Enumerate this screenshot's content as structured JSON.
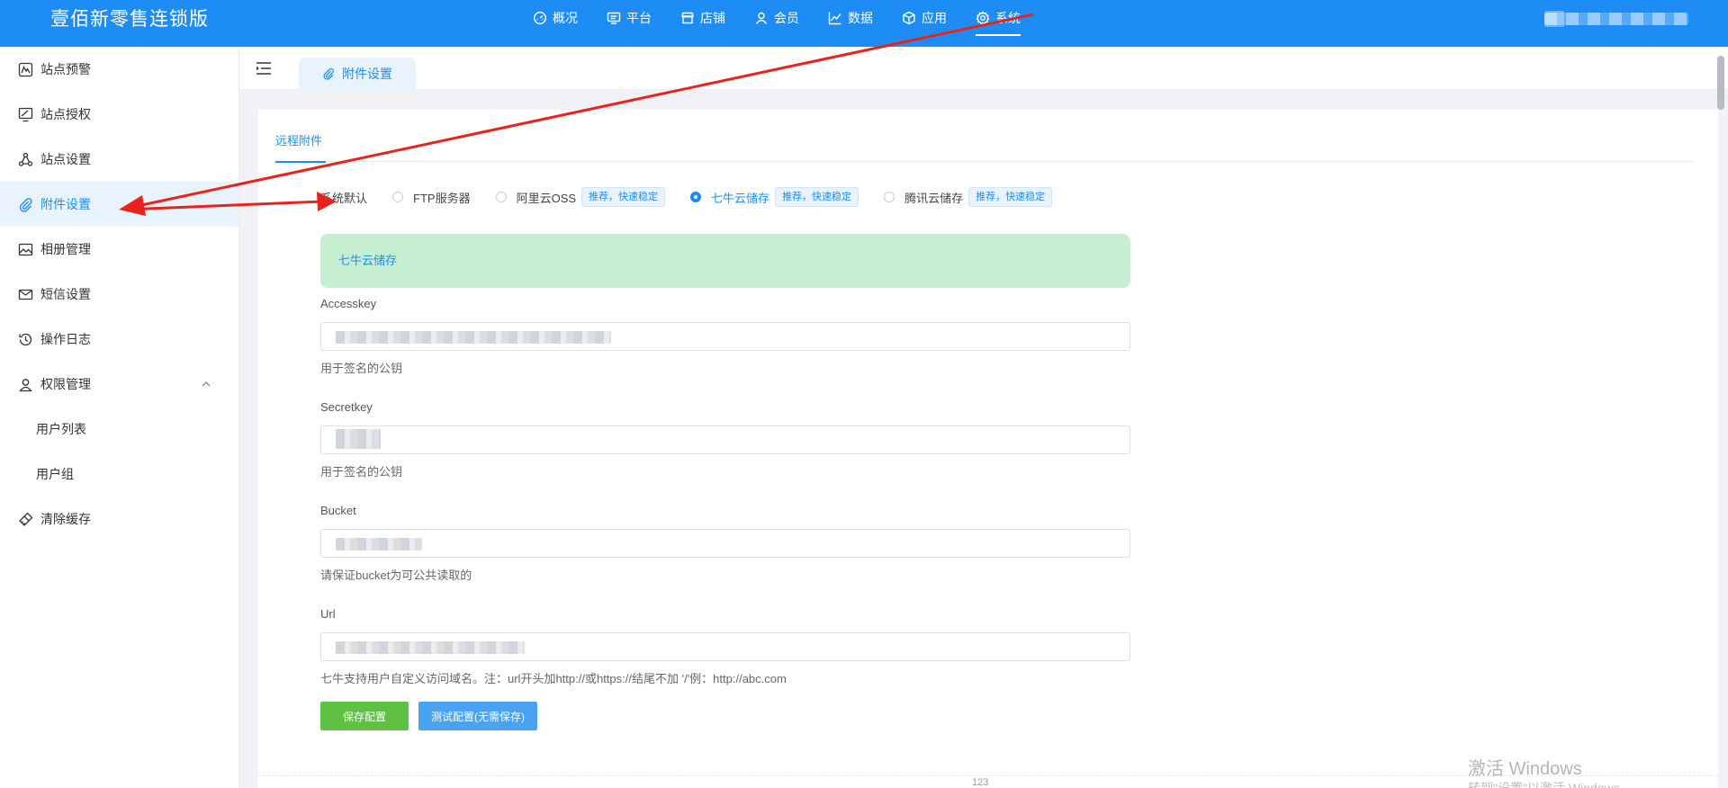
{
  "app": {
    "title": "壹佰新零售连锁版"
  },
  "topnav": [
    {
      "label": "概况",
      "icon": "gauge-icon"
    },
    {
      "label": "平台",
      "icon": "monitor-icon"
    },
    {
      "label": "店铺",
      "icon": "store-icon"
    },
    {
      "label": "会员",
      "icon": "user-icon"
    },
    {
      "label": "数据",
      "icon": "chart-icon"
    },
    {
      "label": "应用",
      "icon": "cube-icon"
    },
    {
      "label": "系统",
      "icon": "gear-icon",
      "active": true
    }
  ],
  "sidebar": {
    "items": [
      {
        "label": "站点预警"
      },
      {
        "label": "站点授权"
      },
      {
        "label": "站点设置"
      },
      {
        "label": "附件设置",
        "active": true
      },
      {
        "label": "相册管理"
      },
      {
        "label": "短信设置"
      },
      {
        "label": "操作日志"
      },
      {
        "label": "权限管理"
      }
    ],
    "sub_items": [
      {
        "label": "用户列表"
      },
      {
        "label": "用户组"
      }
    ],
    "last_item": {
      "label": "清除缓存"
    }
  },
  "tabbar": {
    "page_tab": "附件设置"
  },
  "panel": {
    "subtab": "远程附件",
    "storage_options": [
      {
        "label": "系统默认",
        "checked": false,
        "badge": ""
      },
      {
        "label": "FTP服务器",
        "checked": false,
        "badge": ""
      },
      {
        "label": "阿里云OSS",
        "checked": false,
        "badge": "推荐，快速稳定"
      },
      {
        "label": "七牛云储存",
        "checked": true,
        "badge": "推荐，快速稳定"
      },
      {
        "label": "腾讯云储存",
        "checked": false,
        "badge": "推荐，快速稳定"
      }
    ],
    "notice": "七牛云储存",
    "fields": {
      "accesskey": {
        "label": "Accesskey",
        "help": "用于签名的公钥"
      },
      "secretkey": {
        "label": "Secretkey",
        "help": "用于签名的公钥"
      },
      "bucket": {
        "label": "Bucket",
        "help": "请保证bucket为可公共读取的"
      },
      "url": {
        "label": "Url",
        "help": "七牛支持用户自定义访问域名。注：url开头加http://或https://结尾不加 '/'例：http://abc.com"
      }
    },
    "buttons": {
      "save": "保存配置",
      "test": "测试配置(无需保存)"
    },
    "footer": "123"
  },
  "watermark": {
    "title": "激活 Windows",
    "subtitle": "转到\"设置\"以激活 Windows。"
  },
  "colors": {
    "primary": "#1d8df5",
    "success": "#5fc043",
    "notice_bg": "#c6efd1",
    "annotation": "#e8231e"
  }
}
